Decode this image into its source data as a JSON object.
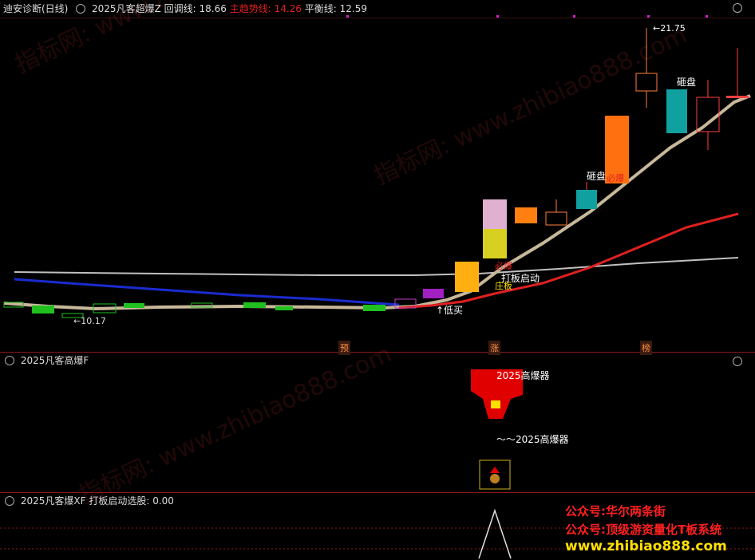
{
  "main_panel": {
    "stock_name": "迪安诊断(日线)",
    "indicator_name": "2025凡客超爆Z",
    "pullback_label": "回调线:",
    "pullback_value": "18.66",
    "trend_label": "主趋势线:",
    "trend_value": "14.26",
    "balance_label": "平衡线:",
    "balance_value": "12.59",
    "high_label": "21.75",
    "low_label": "10.17",
    "annotations": {
      "smash1": "砸盘",
      "smash2": "砸盘",
      "explode": "必爆",
      "board_start": "打板启动",
      "zhuang": "庄板",
      "low_buy": "↑低买",
      "blast": "必爆"
    },
    "markers": [
      "预",
      "涨",
      "榜"
    ]
  },
  "panel2": {
    "title": "2025凡客高爆F",
    "label1": "2025高爆器",
    "label2": "～～2025高爆器"
  },
  "panel3": {
    "title": "2025凡客爆XF",
    "field_label": "打板启动选股:",
    "field_value": "0.00"
  },
  "watermark": {
    "text": "指标网: www.zhibiao888.com",
    "promo1": "公众号:华尔两条街",
    "promo2": "公众号:顶级游资量化T板系统",
    "promo3": "www.zhibiao888.com"
  },
  "colors": {
    "trend": "#e02020",
    "pullback": "#c8b89a",
    "balance": "#c0c0c0",
    "blue_line": "#1a2bd0",
    "up": "#ff2020",
    "down": "#00e0e0"
  }
}
